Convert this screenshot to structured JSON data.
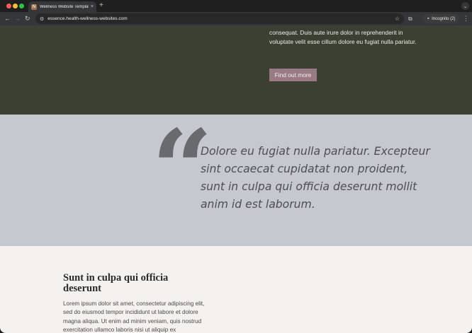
{
  "browser": {
    "tab_favicon_letter": "N",
    "tab_title": "Wellness Website Template -",
    "tab_close": "×",
    "new_tab": "+",
    "url": "essence.health-wellness-websites.com",
    "incognito_label": "Incognito (2)"
  },
  "hero": {
    "text": "consequat. Duis aute irure dolor in reprehenderit in voluptate velit esse cillum dolore eu fugiat nulla pariatur.",
    "button_label": "Find out more"
  },
  "quote": {
    "mark": "“",
    "text": "Dolore eu fugiat nulla pariatur. Excepteur sint occaecat cupidatat non proident, sunt in culpa qui officia deserunt mollit anim id est laborum."
  },
  "section": {
    "title": "Sunt in culpa qui officia deserunt",
    "body": "Lorem ipsum dolor sit amet, consectetur adipiscing elit, sed do eiusmod tempor incididunt ut labore et dolore magna aliqua. Ut enim ad minim veniam, quis nostrud exercitation ullamco laboris nisi ut aliquip ex"
  },
  "colors": {
    "hero_bg": "#3c4033",
    "button_bg": "#9a7a85",
    "quote_bg": "#c5c8ce",
    "lower_bg": "#f5f1ee"
  }
}
